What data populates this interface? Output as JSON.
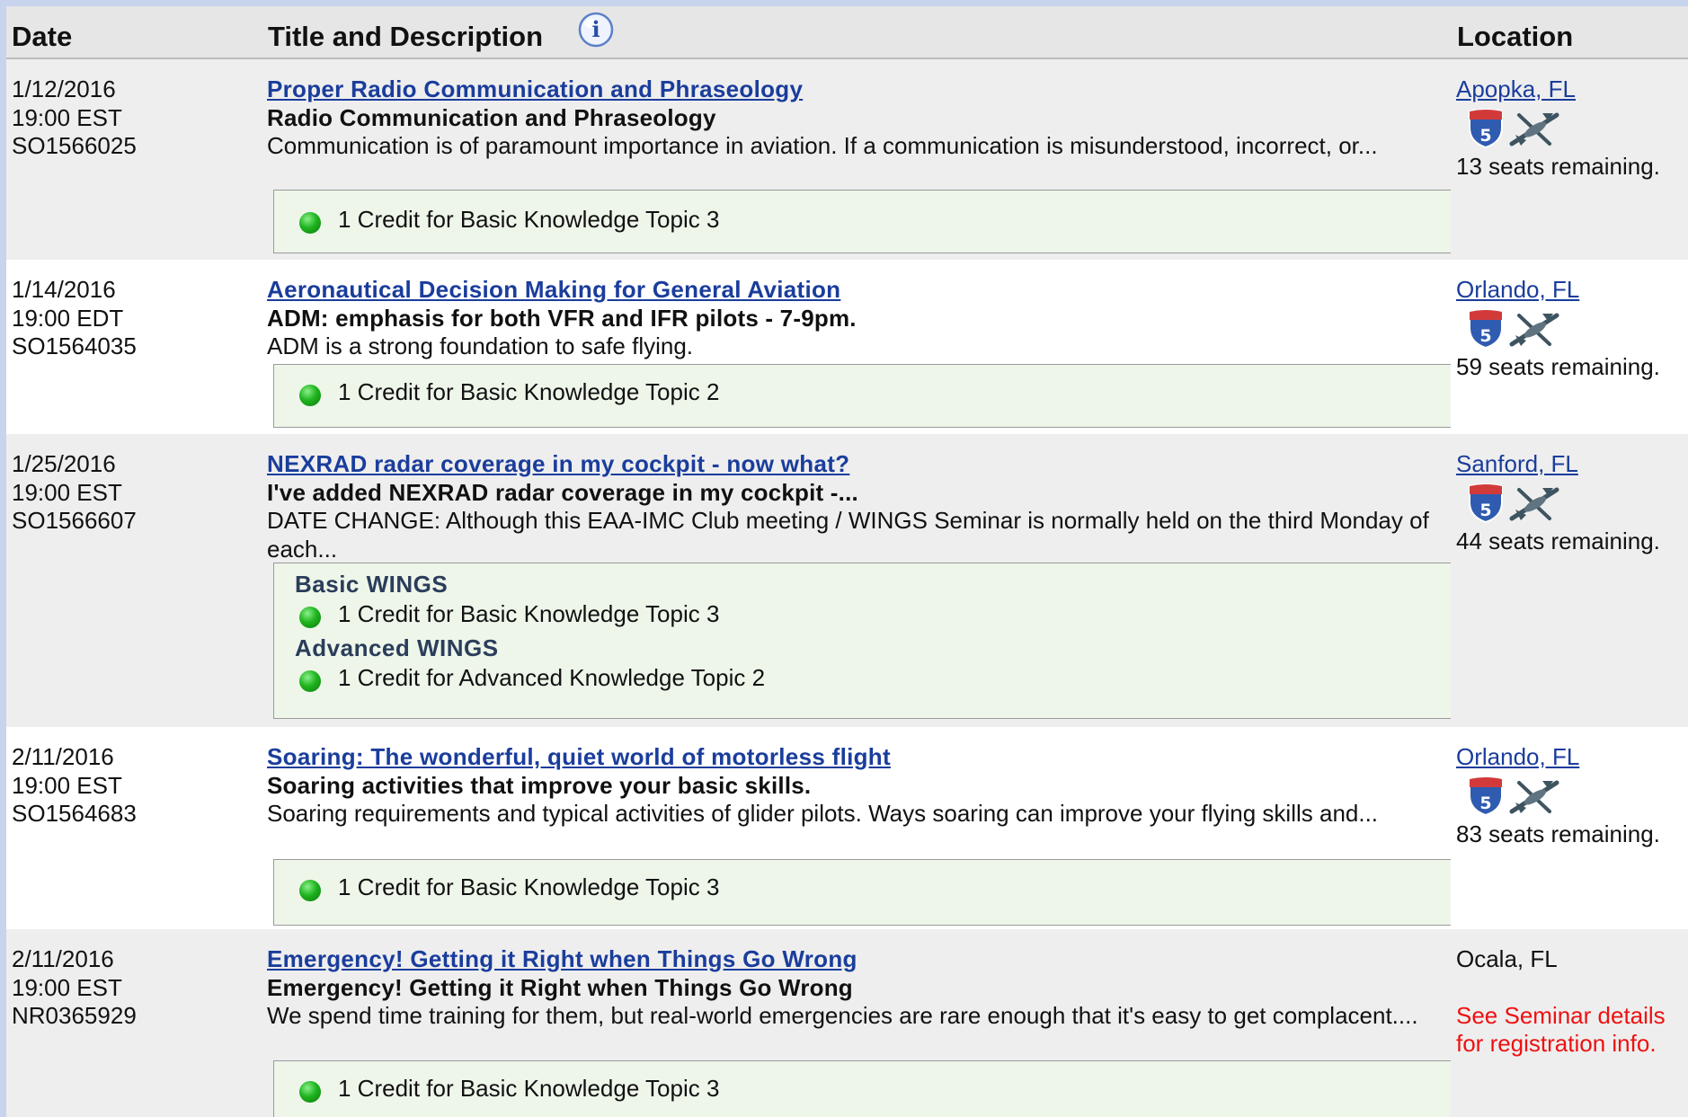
{
  "header": {
    "date": "Date",
    "title": "Title and Description",
    "location": "Location",
    "info_icon": "info-icon"
  },
  "colors": {
    "link": "#1a3d9c",
    "header_bg": "#e6e6e6",
    "row_shade": "#eeeeee",
    "credit_bg": "#eef6ea",
    "credit_dot": "#1fb41f",
    "warning": "#ee1111"
  },
  "seminars": [
    {
      "date": "1/12/2016",
      "time": "19:00 EST",
      "id": "SO1566025",
      "title": "Proper Radio Communication and Phraseology",
      "subtitle": "Radio Communication and Phraseology",
      "description": "Communication is of paramount importance in aviation. If a communication is misunderstood, incorrect, or...",
      "credits": [
        {
          "text": "1 Credit for Basic Knowledge Topic 3"
        }
      ],
      "location": "Apopka, FL",
      "seats": "13 seats remaining."
    },
    {
      "date": "1/14/2016",
      "time": "19:00 EDT",
      "id": "SO1564035",
      "title": "Aeronautical Decision Making for General Aviation",
      "subtitle": "ADM: emphasis for both VFR and IFR pilots - 7-9pm.",
      "description": "ADM is a strong foundation to safe flying.",
      "credits": [
        {
          "text": "1 Credit for Basic Knowledge Topic 2"
        }
      ],
      "location": "Orlando, FL",
      "seats": "59 seats remaining."
    },
    {
      "date": "1/25/2016",
      "time": "19:00 EST",
      "id": "SO1566607",
      "title": "NEXRAD radar coverage in my cockpit - now what?",
      "subtitle": "I've added NEXRAD radar coverage in my cockpit -...",
      "description": "DATE CHANGE: Although this EAA-IMC Club meeting / WINGS Seminar is normally held on the third Monday of each...",
      "credit_groups": [
        {
          "name": "Basic WINGS",
          "text": "1 Credit for Basic Knowledge Topic 3"
        },
        {
          "name": "Advanced WINGS",
          "text": "1 Credit for Advanced Knowledge Topic 2"
        }
      ],
      "location": "Sanford, FL",
      "seats": "44 seats remaining."
    },
    {
      "date": "2/11/2016",
      "time": "19:00 EST",
      "id": "SO1564683",
      "title": "Soaring: The wonderful, quiet world of motorless flight",
      "subtitle": "Soaring activities that improve your basic skills.",
      "description": "Soaring requirements and typical activities of glider pilots. Ways soaring can improve your flying skills and...",
      "credits": [
        {
          "text": "1 Credit for Basic Knowledge Topic 3"
        }
      ],
      "location": "Orlando, FL",
      "seats": "83 seats remaining."
    },
    {
      "date": "2/11/2016",
      "time": "19:00 EST",
      "id": "NR0365929",
      "title": "Emergency! Getting it Right when Things Go Wrong",
      "subtitle": "Emergency! Getting it Right when Things Go Wrong",
      "description": "We spend time training for them, but real-world emergencies are rare enough that it's easy to get complacent....",
      "credits": [
        {
          "text": "1 Credit for Basic Knowledge Topic 3"
        }
      ],
      "location": "Ocala, FL",
      "note_line1": "See Seminar details",
      "note_line2": "for registration info."
    }
  ]
}
